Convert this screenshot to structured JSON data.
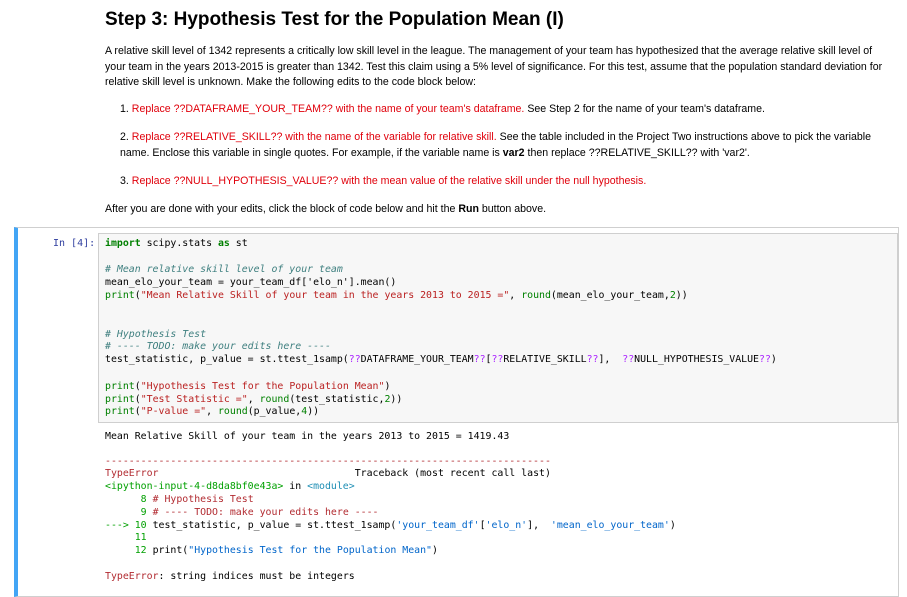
{
  "markdown": {
    "title": "Step 3: Hypothesis Test for the Population Mean (I)",
    "paragraph": "A relative skill level of 1342 represents a critically low skill level in the league. The management of your team has hypothesized that the average relative skill level of your team in the years 2013-2015 is greater than 1342. Test this claim using a 5% level of significance. For this test, assume that the population standard deviation for relative skill level is unknown. Make the following edits to the code block below:",
    "items": [
      {
        "num": "1.",
        "red": "Replace ??DATAFRAME_YOUR_TEAM?? with the name of your team's dataframe.",
        "black": " See Step 2 for the name of your team's dataframe."
      },
      {
        "num": "2.",
        "red": "Replace ??RELATIVE_SKILL?? with the name of the variable for relative skill.",
        "black": " See the table included in the Project Two instructions above to pick the variable name. Enclose this variable in single quotes. For example, if the variable name is ",
        "bold": "var2",
        "black2": " then replace ??RELATIVE_SKILL?? with 'var2'."
      },
      {
        "num": "3.",
        "red": "Replace ??NULL_HYPOTHESIS_VALUE?? with the mean value of the relative skill under the null hypothesis.",
        "black": ""
      }
    ],
    "after_pre": "After you are done with your edits, click the block of code below and hit the ",
    "after_bold": "Run",
    "after_post": " button above."
  },
  "code_cell": {
    "prompt": "In [4]:",
    "lines": [
      "import scipy.stats as st",
      "",
      "# Mean relative skill level of your team",
      "mean_elo_your_team = your_team_df['elo_n'].mean()",
      "print(\"Mean Relative Skill of your team in the years 2013 to 2015 =\", round(mean_elo_your_team,2))",
      "",
      "",
      "# Hypothesis Test",
      "# ---- TODO: make your edits here ----",
      "test_statistic, p_value = st.ttest_1samp(??DATAFRAME_YOUR_TEAM??[??RELATIVE_SKILL??],  ??NULL_HYPOTHESIS_VALUE??)",
      "",
      "print(\"Hypothesis Test for the Population Mean\")",
      "print(\"Test Statistic =\", round(test_statistic,2))",
      "print(\"P-value =\", round(p_value,4))"
    ]
  },
  "output": {
    "stdout": "Mean Relative Skill of your team in the years 2013 to 2015 = 1419.43",
    "dashes": "---------------------------------------------------------------------------",
    "error_type": "TypeError",
    "traceback_label": "Traceback (most recent call last)",
    "input_ref": "<ipython-input-4-d8da8bf0e43a>",
    "in_word": " in ",
    "module": "<module>",
    "tb_line8_num": "8",
    "tb_line8": "# Hypothesis Test",
    "tb_line9_num": "9",
    "tb_line9": "# ---- TODO: make your edits here ----",
    "tb_arrow": "---> 10",
    "tb_line10_pre": " test_statistic, p_value = st.ttest_1samp(",
    "tb_line10_str1": "'your_team_df'",
    "tb_line10_mid": "[",
    "tb_line10_str2": "'elo_n'",
    "tb_line10_mid2": "],  ",
    "tb_line10_str3": "'mean_elo_your_team'",
    "tb_line10_end": ")",
    "tb_line11_num": "11",
    "tb_line12_num": "12",
    "tb_line12_pre": "print(",
    "tb_line12_str": "\"Hypothesis Test for the Population Mean\"",
    "tb_line12_end": ")",
    "final_msg": ": string indices must be integers"
  }
}
